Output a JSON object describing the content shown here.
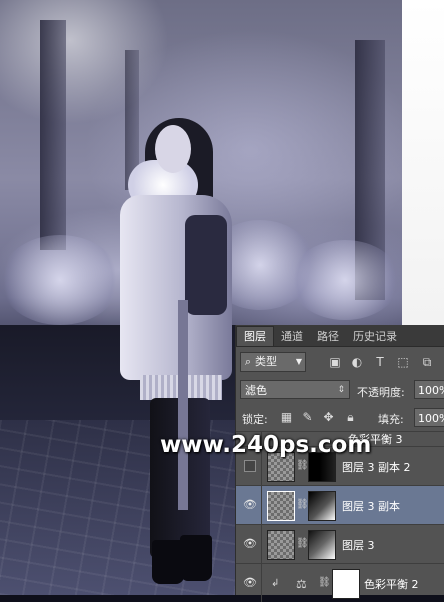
{
  "watermark": "www.240ps.com",
  "layers_panel": {
    "tabs": [
      "图层",
      "通道",
      "路径",
      "历史记录"
    ],
    "active_tab": "图层",
    "filter": {
      "kind_label": "类型"
    },
    "blend_mode": "滤色",
    "opacity_label": "不透明度:",
    "opacity_value": "100%",
    "lock_label": "锁定:",
    "fill_label": "填充:",
    "fill_value": "100%",
    "layers": [
      {
        "name": "色彩平衡 3",
        "visible": false,
        "selected": false,
        "partial": true
      },
      {
        "name": "图层 3 副本 2",
        "visible": false,
        "selected": false
      },
      {
        "name": "图层 3 副本",
        "visible": true,
        "selected": true
      },
      {
        "name": "图层 3",
        "visible": true,
        "selected": false
      },
      {
        "name": "色彩平衡 2",
        "visible": true,
        "selected": false
      }
    ]
  }
}
